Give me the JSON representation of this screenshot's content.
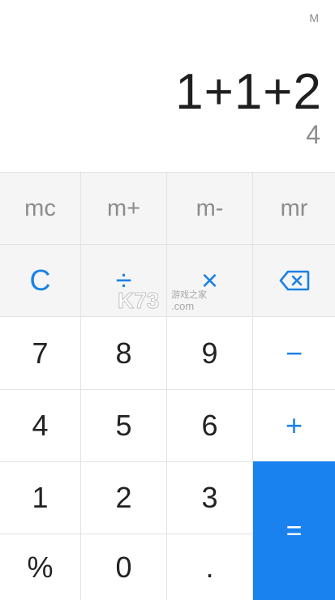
{
  "display": {
    "memory_indicator": "M",
    "expression": "1+1+2",
    "result": "4"
  },
  "memory_keys": {
    "mc": "mc",
    "m_plus": "m+",
    "m_minus": "m-",
    "mr": "mr"
  },
  "function_keys": {
    "clear": "C",
    "divide": "÷",
    "multiply": "×",
    "backspace_icon": "backspace-icon"
  },
  "digits": {
    "d7": "7",
    "d8": "8",
    "d9": "9",
    "d4": "4",
    "d5": "5",
    "d6": "6",
    "d1": "1",
    "d2": "2",
    "d3": "3",
    "d0": "0"
  },
  "operators": {
    "minus": "−",
    "plus": "+",
    "equals": "=",
    "percent": "%",
    "decimal": "."
  },
  "watermark": {
    "brand": "K73",
    "sub_text": "游戏之家",
    "domain": ".com"
  },
  "colors": {
    "accent": "#1a82e6",
    "equals_bg": "#1a82ee",
    "function_row_bg": "#f5f5f5"
  }
}
